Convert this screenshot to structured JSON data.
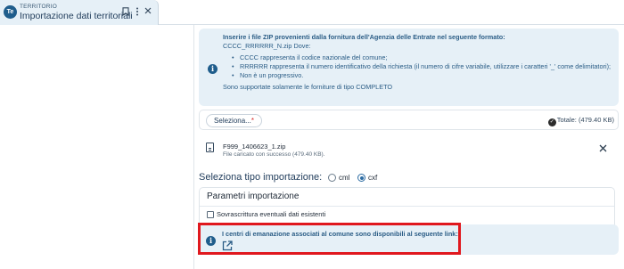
{
  "tab": {
    "logo": "Te",
    "context": "TERRITORIO",
    "title": "Importazione dati territoriali",
    "pin_icon": "bookmark-icon",
    "menu_icon": "vertical-dots-icon",
    "close_icon": "close-icon"
  },
  "info": {
    "heading": "Inserire i file ZIP provenienti dalla fornitura dell'Agenzia delle Entrate nel seguente formato:",
    "format": "CCCC_RRRRRR_N.zip Dove:",
    "items": [
      "CCCC rappresenta il codice nazionale del comune;",
      "RRRRRR rappresenta il numero identificativo della richiesta (il numero di cifre variabile, utilizzare i caratteri '_' come delimitatori);",
      "Non è un progressivo."
    ],
    "footer": "Sono supportate solamente le forniture di tipo COMPLETO"
  },
  "upload": {
    "select_label": "Seleziona...",
    "required_mark": "*",
    "total_label": "Totale: (479.40 KB)"
  },
  "file": {
    "name": "F999_1406623_1.zip",
    "status": "File caricato con successo (479.40 KB)."
  },
  "import_type": {
    "label": "Seleziona tipo importazione:",
    "options": [
      "cml",
      "cxf"
    ],
    "selected": "cxf"
  },
  "params": {
    "title": "Parametri importazione",
    "overwrite_label": "Sovrascrittura eventuali dati esistenti",
    "overwrite_checked": false
  },
  "info2": {
    "text": "I centri di emanazione associati al comune sono disponibili al seguente link:"
  },
  "colors": {
    "accent": "#1f5d8c",
    "info_bg": "#e6f0f7",
    "highlight": "#e0181e"
  }
}
